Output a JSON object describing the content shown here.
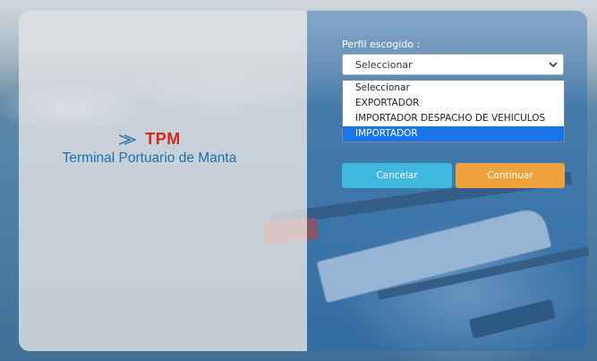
{
  "brand": {
    "short": "TPM",
    "name": "Terminal Portuario de Manta",
    "accent_red": "#d9261c",
    "accent_blue": "#1f6fa8"
  },
  "form": {
    "label": "Perfil escogido :",
    "select_value": "Seleccionar",
    "options": [
      "Seleccionar",
      "EXPORTADOR",
      "IMPORTADOR DESPACHO DE VEHICULOS",
      "IMPORTADOR"
    ],
    "highlighted_option": "IMPORTADOR"
  },
  "buttons": {
    "cancel": "Cancelar",
    "continue": "Continuar"
  },
  "icons": {
    "logo": "arrow-logo-icon",
    "dropdown": "chevron-down-icon"
  }
}
